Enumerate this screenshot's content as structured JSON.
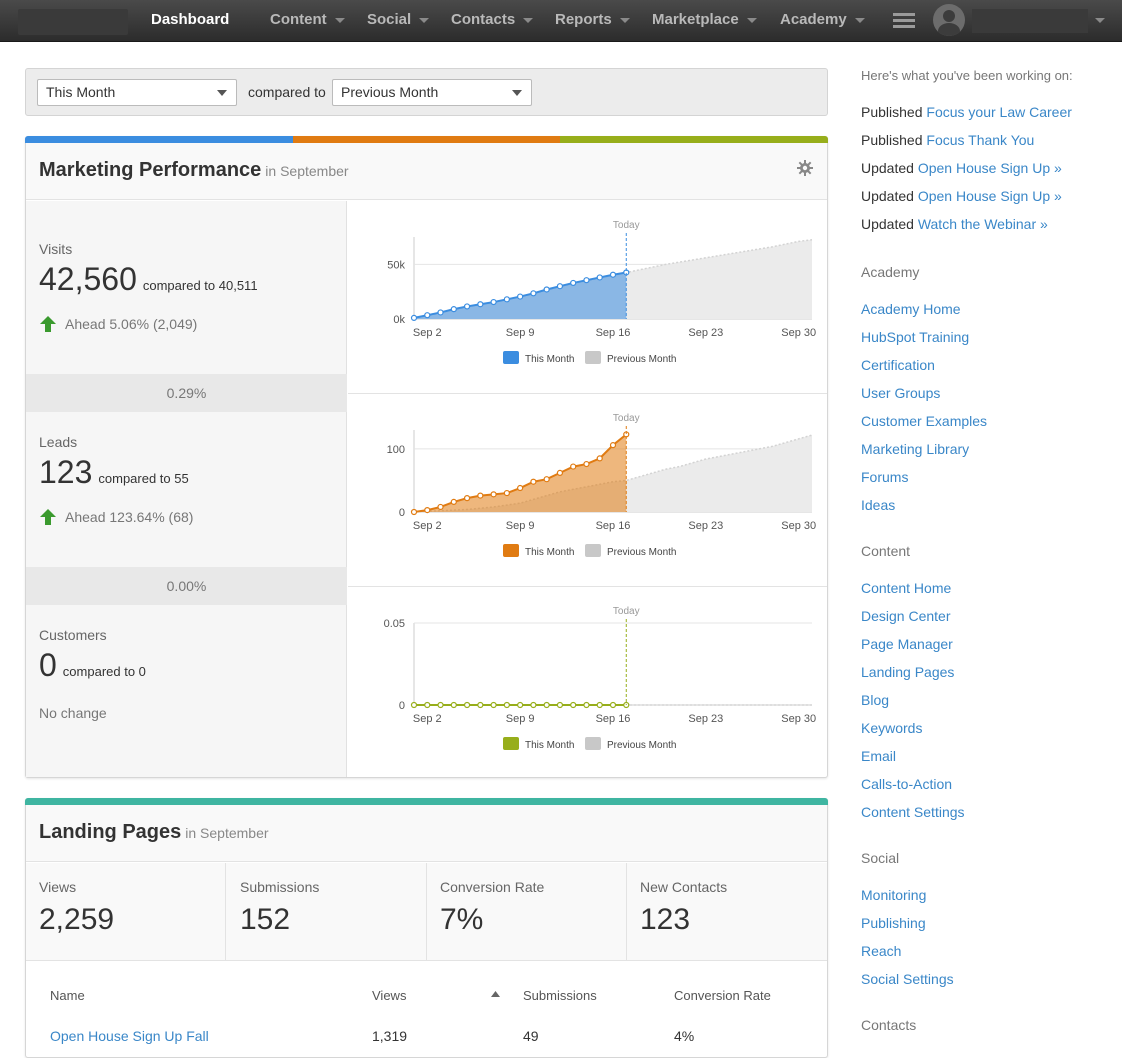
{
  "nav": {
    "items": [
      {
        "label": "Dashboard",
        "dropdown": false
      },
      {
        "label": "Content",
        "dropdown": true
      },
      {
        "label": "Social",
        "dropdown": true
      },
      {
        "label": "Contacts",
        "dropdown": true
      },
      {
        "label": "Reports",
        "dropdown": true
      },
      {
        "label": "Marketplace",
        "dropdown": true
      },
      {
        "label": "Academy",
        "dropdown": true
      }
    ]
  },
  "filter": {
    "period": "This Month",
    "compared_label": "compared to",
    "comparison": "Previous Month"
  },
  "marketing": {
    "title": "Marketing Performance",
    "subtitle": "in September",
    "colors": [
      "#3b8de0",
      "#e07b12",
      "#97ae1b"
    ],
    "metrics": [
      {
        "label": "Visits",
        "value": "42,560",
        "compared": "compared to 40,511",
        "trend": "Ahead 5.06% (2,049)"
      },
      {
        "label": "Leads",
        "value": "123",
        "compared": "compared to 55",
        "trend": "Ahead 123.64% (68)"
      },
      {
        "label": "Customers",
        "value": "0",
        "compared": "compared to 0",
        "trend": "No change"
      }
    ],
    "conversion_rates": [
      "0.29%",
      "0.00%"
    ]
  },
  "chart_data": [
    {
      "type": "area",
      "title": "",
      "today_label": "Today",
      "x_ticks": [
        "Sep 2",
        "Sep 9",
        "Sep 16",
        "Sep 23",
        "Sep 30"
      ],
      "y_ticks": [
        "0k",
        "50k"
      ],
      "ylim": [
        0,
        75000
      ],
      "series": [
        {
          "name": "This Month",
          "color": "#3b8de0",
          "values": [
            1000,
            3500,
            6000,
            9000,
            11500,
            13500,
            15500,
            18000,
            20500,
            23500,
            27000,
            30000,
            33000,
            35500,
            38000,
            40500,
            42560
          ]
        },
        {
          "name": "Previous Month",
          "color": "#c8c8c8",
          "values": [
            1000,
            3000,
            5500,
            8500,
            11000,
            13500,
            15500,
            18000,
            20500,
            23000,
            26500,
            29500,
            32500,
            35000,
            37500,
            40000,
            42500,
            45000,
            47500,
            50000,
            52000,
            54000,
            56000,
            58000,
            60000,
            62000,
            64000,
            66000,
            68500,
            71000,
            72500
          ]
        }
      ]
    },
    {
      "type": "area",
      "title": "",
      "today_label": "Today",
      "x_ticks": [
        "Sep 2",
        "Sep 9",
        "Sep 16",
        "Sep 23",
        "Sep 30"
      ],
      "y_ticks": [
        "0",
        "100"
      ],
      "ylim": [
        0,
        130
      ],
      "series": [
        {
          "name": "This Month",
          "color": "#e07b12",
          "values": [
            0,
            3,
            8,
            16,
            22,
            26,
            28,
            30,
            38,
            48,
            52,
            62,
            72,
            76,
            85,
            106,
            123
          ]
        },
        {
          "name": "Previous Month",
          "color": "#c8c8c8",
          "values": [
            0,
            1,
            2,
            3,
            4,
            6,
            8,
            11,
            14,
            20,
            26,
            32,
            36,
            40,
            44,
            48,
            50,
            56,
            62,
            68,
            72,
            78,
            84,
            88,
            92,
            96,
            100,
            104,
            110,
            116,
            122
          ]
        }
      ]
    },
    {
      "type": "area",
      "title": "",
      "today_label": "Today",
      "x_ticks": [
        "Sep 2",
        "Sep 9",
        "Sep 16",
        "Sep 23",
        "Sep 30"
      ],
      "y_ticks": [
        "0",
        "0.05"
      ],
      "ylim": [
        0,
        0.05
      ],
      "series": [
        {
          "name": "This Month",
          "color": "#97ae1b",
          "values": [
            0,
            0,
            0,
            0,
            0,
            0,
            0,
            0,
            0,
            0,
            0,
            0,
            0,
            0,
            0,
            0,
            0
          ]
        },
        {
          "name": "Previous Month",
          "color": "#c8c8c8",
          "values": [
            0,
            0,
            0,
            0,
            0,
            0,
            0,
            0,
            0,
            0,
            0,
            0,
            0,
            0,
            0,
            0,
            0,
            0,
            0,
            0,
            0,
            0,
            0,
            0,
            0,
            0,
            0,
            0,
            0,
            0,
            0
          ]
        }
      ]
    }
  ],
  "landing": {
    "title": "Landing Pages",
    "subtitle": "in September",
    "color": "#3fb5a1",
    "stats": [
      {
        "label": "Views",
        "value": "2,259"
      },
      {
        "label": "Submissions",
        "value": "152"
      },
      {
        "label": "Conversion Rate",
        "value": "7%"
      },
      {
        "label": "New Contacts",
        "value": "123"
      }
    ],
    "table": {
      "headers": [
        "Name",
        "Views",
        "Submissions",
        "Conversion Rate"
      ],
      "rows": [
        [
          "Open House Sign Up Fall",
          "1,319",
          "49",
          "4%"
        ]
      ]
    }
  },
  "sidebar": {
    "activity_title": "Here's what you've been working on:",
    "activity": [
      {
        "action": "Published",
        "item": "Focus your Law Career"
      },
      {
        "action": "Published",
        "item": "Focus Thank You"
      },
      {
        "action": "Updated",
        "item": "Open House Sign Up »"
      },
      {
        "action": "Updated",
        "item": "Open House Sign Up »"
      },
      {
        "action": "Updated",
        "item": "Watch the Webinar »"
      }
    ],
    "sections": [
      {
        "title": "Academy",
        "links": [
          "Academy Home",
          "HubSpot Training",
          "Certification",
          "User Groups",
          "Customer Examples",
          "Marketing Library",
          "Forums",
          "Ideas"
        ]
      },
      {
        "title": "Content",
        "links": [
          "Content Home",
          "Design Center",
          "Page Manager",
          "Landing Pages",
          "Blog",
          "Keywords",
          "Email",
          "Calls-to-Action",
          "Content Settings"
        ]
      },
      {
        "title": "Social",
        "links": [
          "Monitoring",
          "Publishing",
          "Reach",
          "Social Settings"
        ]
      },
      {
        "title": "Contacts",
        "links": []
      }
    ]
  }
}
